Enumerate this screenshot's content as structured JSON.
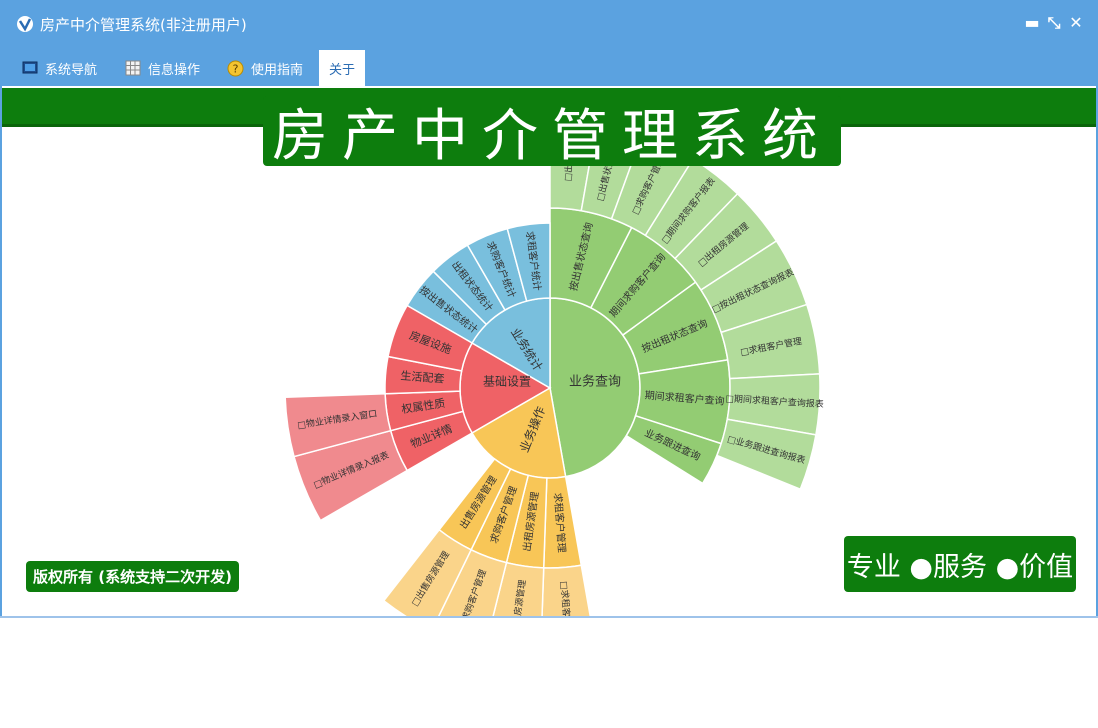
{
  "window": {
    "title": "房产中介管理系统(非注册用户)",
    "controls": {
      "minimize": "▬",
      "restore": "⤡",
      "close": "✕"
    }
  },
  "menu": {
    "items": [
      {
        "label": "系统导航",
        "icon": "monitor-icon"
      },
      {
        "label": "信息操作",
        "icon": "grid-icon"
      },
      {
        "label": "使用指南",
        "icon": "help-icon"
      },
      {
        "label": "关于",
        "icon": ""
      }
    ],
    "active": "关于"
  },
  "banner": {
    "title": "房产中介管理系统"
  },
  "footer": {
    "copyright": "版权所有 (系统支持二次开发)",
    "slogan": "专业 ●服务 ●价值"
  },
  "colors": {
    "titlebar": "#5ba2e0",
    "brand_green": "#0d7d0d",
    "segment_query": "#93cc73",
    "segment_query_outer": "#b2dc9b",
    "segment_stats": "#79bfdd",
    "segment_base": "#ef6266",
    "segment_base_outer": "#f08a8e",
    "segment_ops": "#f8c657",
    "segment_ops_outer": "#fad48a"
  },
  "sunburst": {
    "center_segments": [
      {
        "label": "业务查询",
        "color": "#93cc73"
      },
      {
        "label": "业务统计",
        "color": "#79bfdd"
      },
      {
        "label": "基础设置",
        "color": "#ef6266"
      },
      {
        "label": "业务操作",
        "color": "#f8c657"
      }
    ],
    "query_children": [
      {
        "label": "按出售状态查询",
        "child": "□出售..."
      },
      {
        "label": "期间求购客户查询",
        "child": "□出售状态查询"
      },
      {
        "label": "按出租状态查询",
        "child": "□求购客户管理"
      },
      {
        "label": "期间求租客户查询",
        "child": "□期间求购客户报表"
      },
      {
        "label": "业务跟进查询",
        "child": "□出租房源管理"
      }
    ],
    "query_outer": [
      "□出售...",
      "□出售状态查询",
      "□求购客户管理",
      "□期间求购客户报表",
      "□出租房源管理",
      "□按出租状态查询报表",
      "□求租客户管理",
      "□期间求租客户查询报表",
      "□业务跟进查询报表"
    ],
    "stats_children": [
      "按出售状态统计",
      "出租状态统计",
      "求购客户统计",
      "求租客户统计"
    ],
    "base_children": [
      "房屋设施",
      "生活配套",
      "权属性质",
      "物业详情"
    ],
    "base_outer": [
      "□物业详情录入报表",
      "□物业详情录入窗口"
    ],
    "ops_children": [
      "求租客户管理",
      "出租房源管理",
      "求购客户管理",
      "出售房源管理"
    ],
    "ops_outer": [
      "□求租客户管理",
      "□出租房源管理",
      "□求购客户管理",
      "□出售房源管理"
    ]
  }
}
